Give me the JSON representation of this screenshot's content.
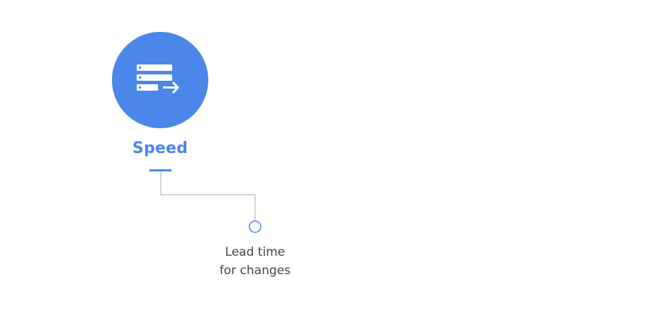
{
  "category": {
    "title": "Speed",
    "icon": "server-rack-arrow-icon",
    "color": "#4a87e8"
  },
  "metrics": [
    {
      "label_line1": "Lead time",
      "label_line2": "for changes"
    }
  ],
  "colors": {
    "accent": "#4a87e8",
    "connector": "#c6c6c6",
    "text": "#444444",
    "background": "#ffffff"
  }
}
